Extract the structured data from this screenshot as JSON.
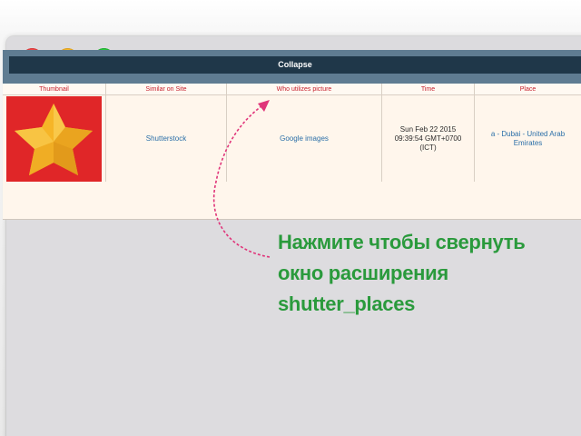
{
  "window": {
    "controls": [
      "close",
      "minimize",
      "zoom"
    ]
  },
  "panel": {
    "collapse_label": "Collapse"
  },
  "table": {
    "headers": [
      "Thumbnail",
      "Similar on Site",
      "Who utilizes picture",
      "Time",
      "Place"
    ],
    "row": {
      "thumbnail_icon": "star-icon",
      "similar_on_site": "Shutterstock",
      "who_utilizes": "Google images",
      "time_line1": "Sun Feb 22 2015",
      "time_line2": "09:39:54 GMT+0700",
      "time_line3": "(ICT)",
      "place": "a - Dubai - United Arab Emirates"
    }
  },
  "annotation": {
    "line1": "Нажмите чтобы свернуть",
    "line2": "окно расширения",
    "line3": "shutter_places"
  },
  "colors": {
    "annotation_text": "#2a9a3c",
    "arrow": "#e0357a",
    "header_text": "#c6202d",
    "link_text": "#2b6fa8",
    "collapse_bar": "#1f3749",
    "panel_border": "#5f7c92",
    "thumbnail_bg": "#e02628",
    "star": "#f6b527"
  }
}
